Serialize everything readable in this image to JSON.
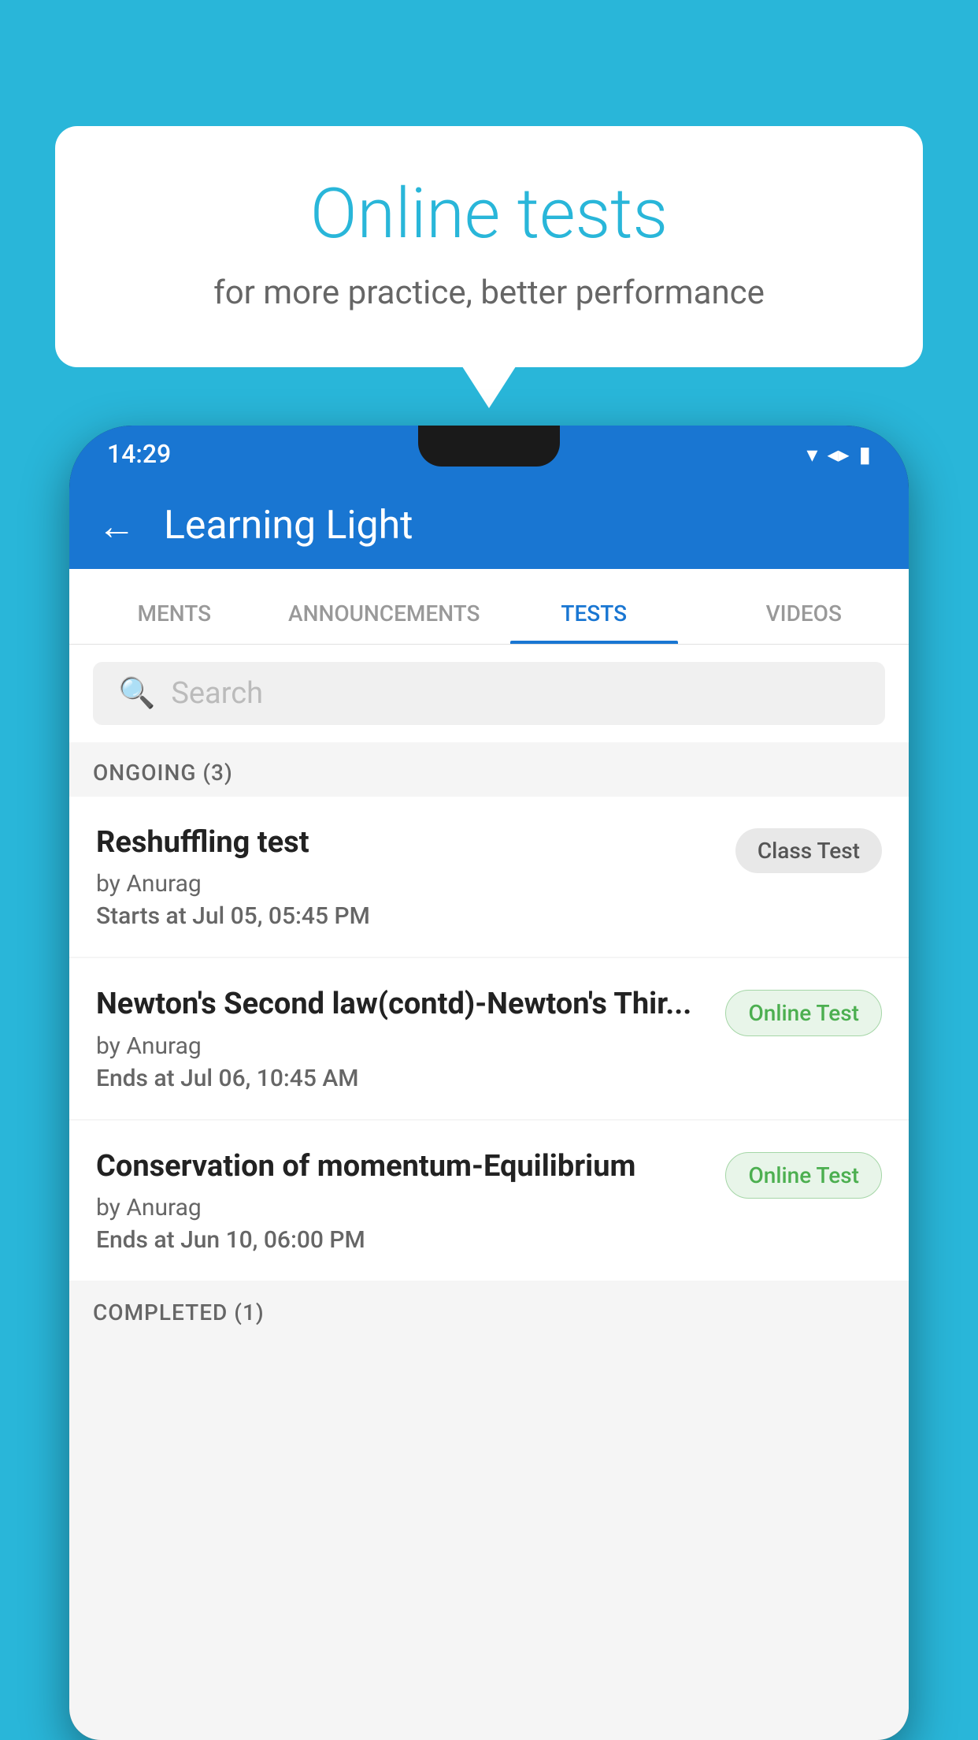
{
  "background_color": "#29b6d9",
  "bubble": {
    "title": "Online tests",
    "subtitle": "for more practice, better performance"
  },
  "status_bar": {
    "time": "14:29",
    "icons": [
      "▾",
      "◂",
      "▮"
    ]
  },
  "app_bar": {
    "back_label": "←",
    "title": "Learning Light"
  },
  "tabs": [
    {
      "label": "MENTS",
      "active": false
    },
    {
      "label": "ANNOUNCEMENTS",
      "active": false
    },
    {
      "label": "TESTS",
      "active": true
    },
    {
      "label": "VIDEOS",
      "active": false
    }
  ],
  "search": {
    "placeholder": "Search",
    "icon": "🔍"
  },
  "ongoing_section": {
    "label": "ONGOING (3)",
    "items": [
      {
        "name": "Reshuffling test",
        "author": "by Anurag",
        "date_label": "Starts at",
        "date": "Jul 05, 05:45 PM",
        "badge": "Class Test",
        "badge_type": "class"
      },
      {
        "name": "Newton's Second law(contd)-Newton's Thir...",
        "author": "by Anurag",
        "date_label": "Ends at",
        "date": "Jul 06, 10:45 AM",
        "badge": "Online Test",
        "badge_type": "online"
      },
      {
        "name": "Conservation of momentum-Equilibrium",
        "author": "by Anurag",
        "date_label": "Ends at",
        "date": "Jun 10, 06:00 PM",
        "badge": "Online Test",
        "badge_type": "online"
      }
    ]
  },
  "completed_section": {
    "label": "COMPLETED (1)"
  }
}
